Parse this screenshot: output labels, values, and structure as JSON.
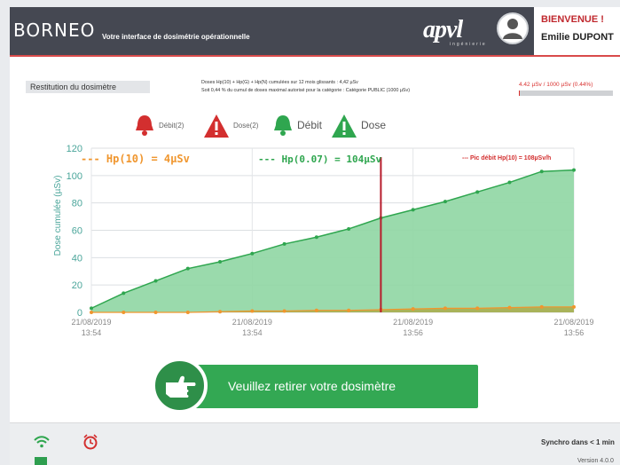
{
  "app": {
    "logo": "BORNEO",
    "tagline": "Votre interface de dosimétrie opérationnelle",
    "brand": "apvl",
    "brand_sub": "ingénierie"
  },
  "user": {
    "welcome": "BIENVENUE !",
    "name": "Emilie DUPONT"
  },
  "summary": {
    "section_label": "Restitution du dosimètre",
    "doses_line": "Doses Hp(10) + Hp(G) + Hp(N) cumulées sur 12 mois glissants : 4,42 µSv",
    "percent_line": "Soit  0,44  % du cumul de doses maximal autorisé pour la catégorie : Catégorie PUBLIC (1000 µSv)",
    "ratio_text": "4.42 µSv / 1000 µSv (0.44%)",
    "ratio_fraction": 0.0044
  },
  "legend": {
    "debit2": "Débit(2)",
    "dose2": "Dose(2)",
    "debit": "Débit",
    "dose": "Dose",
    "colors": {
      "alarm": "#d32f2f",
      "ok": "#2fa64f"
    }
  },
  "annotations": {
    "hp10": "--- Hp(10) = 4µSv",
    "hp007": "--- Hp(0.07) = 104µSv",
    "pic": "--- Pic débit Hp(10) = 108µSv/h"
  },
  "chart_data": {
    "type": "area",
    "ylabel": "Dose cumulée (µSv)",
    "ylim": [
      0,
      120
    ],
    "yticks": [
      0,
      20,
      40,
      60,
      80,
      100,
      120
    ],
    "xticks": [
      "21/08/2019\n13:54",
      "21/08/2019\n13:54",
      "21/08/2019\n13:56",
      "21/08/2019\n13:56"
    ],
    "grid": true,
    "marker_index": 9,
    "series": [
      {
        "name": "Hp(0.07)",
        "color": "#2fa64f",
        "fill": "#8fd6a3",
        "values": [
          3,
          14,
          23,
          32,
          37,
          43,
          50,
          55,
          61,
          69,
          75,
          81,
          88,
          95,
          103,
          104
        ]
      },
      {
        "name": "Hp(10)",
        "color": "#f0962e",
        "fill": "#a9b35a",
        "values": [
          0,
          0,
          0,
          0,
          0.5,
          1,
          1,
          1.5,
          1.5,
          2,
          2.5,
          3,
          3,
          3.5,
          4,
          4
        ]
      }
    ]
  },
  "action": {
    "label": "Veuillez retirer votre dosimètre"
  },
  "footer": {
    "synchro": "Synchro dans < 1 min",
    "version": "Version 4.0.0"
  }
}
